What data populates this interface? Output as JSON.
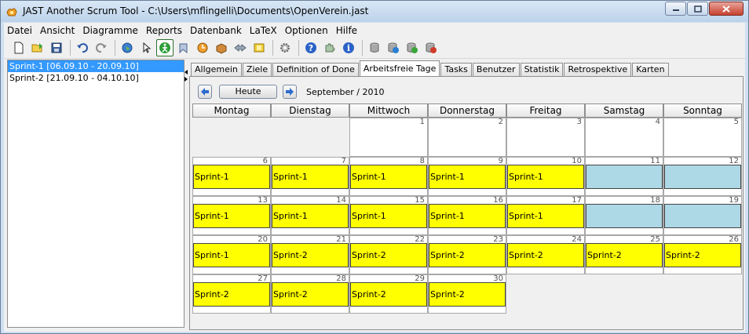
{
  "window": {
    "title": "JAST Another Scrum Tool  -  C:\\Users\\mflingelli\\Documents\\OpenVerein.jast"
  },
  "menu": [
    "Datei",
    "Ansicht",
    "Diagramme",
    "Reports",
    "Datenbank",
    "LaTeX",
    "Optionen",
    "Hilfe"
  ],
  "toolbar": {
    "icons": [
      "new-file-icon",
      "open-folder-icon",
      "save-icon",
      "undo-icon",
      "redo-icon",
      "globe-icon",
      "pointer-icon",
      "person-run-icon",
      "bookmark-icon",
      "clock-icon",
      "box-icon",
      "arrows-icon",
      "folder-book-icon",
      "gear-icon",
      "help-icon",
      "puzzle-icon",
      "info-icon",
      "database-icon",
      "database-export-icon",
      "database-import-icon",
      "database-delete-icon"
    ]
  },
  "sprints": [
    {
      "label": "Sprint-1 [06.09.10 - 20.09.10]",
      "selected": true
    },
    {
      "label": "Sprint-2 [21.09.10 - 04.10.10]",
      "selected": false
    }
  ],
  "tabs": [
    "Allgemein",
    "Ziele",
    "Definition of Done",
    "Arbeitsfreie Tage",
    "Tasks",
    "Benutzer",
    "Statistik",
    "Retrospektive",
    "Karten"
  ],
  "active_tab": "Arbeitsfreie Tage",
  "calendar": {
    "today_label": "Heute",
    "month_label": "September / 2010",
    "weekdays": [
      "Montag",
      "Dienstag",
      "Mittwoch",
      "Donnerstag",
      "Freitag",
      "Samstag",
      "Sonntag"
    ],
    "colors": {
      "sprint": "#ffff00",
      "weekend": "#add8e6"
    },
    "weeks": [
      [
        null,
        null,
        {
          "day": "1"
        },
        {
          "day": "2"
        },
        {
          "day": "3"
        },
        {
          "day": "4"
        },
        {
          "day": "5"
        }
      ],
      [
        {
          "day": "6",
          "sprint": "Sprint-1"
        },
        {
          "day": "7",
          "sprint": "Sprint-1"
        },
        {
          "day": "8",
          "sprint": "Sprint-1"
        },
        {
          "day": "9",
          "sprint": "Sprint-1"
        },
        {
          "day": "10",
          "sprint": "Sprint-1"
        },
        {
          "day": "11",
          "weekend": true
        },
        {
          "day": "12",
          "weekend": true
        }
      ],
      [
        {
          "day": "13",
          "sprint": "Sprint-1"
        },
        {
          "day": "14",
          "sprint": "Sprint-1"
        },
        {
          "day": "15",
          "sprint": "Sprint-1"
        },
        {
          "day": "16",
          "sprint": "Sprint-1"
        },
        {
          "day": "17",
          "sprint": "Sprint-1"
        },
        {
          "day": "18",
          "weekend": true
        },
        {
          "day": "19",
          "weekend": true
        }
      ],
      [
        {
          "day": "20",
          "sprint": "Sprint-1"
        },
        {
          "day": "21",
          "sprint": "Sprint-2"
        },
        {
          "day": "22",
          "sprint": "Sprint-2"
        },
        {
          "day": "23",
          "sprint": "Sprint-2"
        },
        {
          "day": "24",
          "sprint": "Sprint-2"
        },
        {
          "day": "25",
          "sprint": "Sprint-2"
        },
        {
          "day": "26",
          "sprint": "Sprint-2"
        }
      ],
      [
        {
          "day": "27",
          "sprint": "Sprint-2"
        },
        {
          "day": "28",
          "sprint": "Sprint-2"
        },
        {
          "day": "29",
          "sprint": "Sprint-2"
        },
        {
          "day": "30",
          "sprint": "Sprint-2"
        },
        null,
        null,
        null
      ]
    ]
  }
}
